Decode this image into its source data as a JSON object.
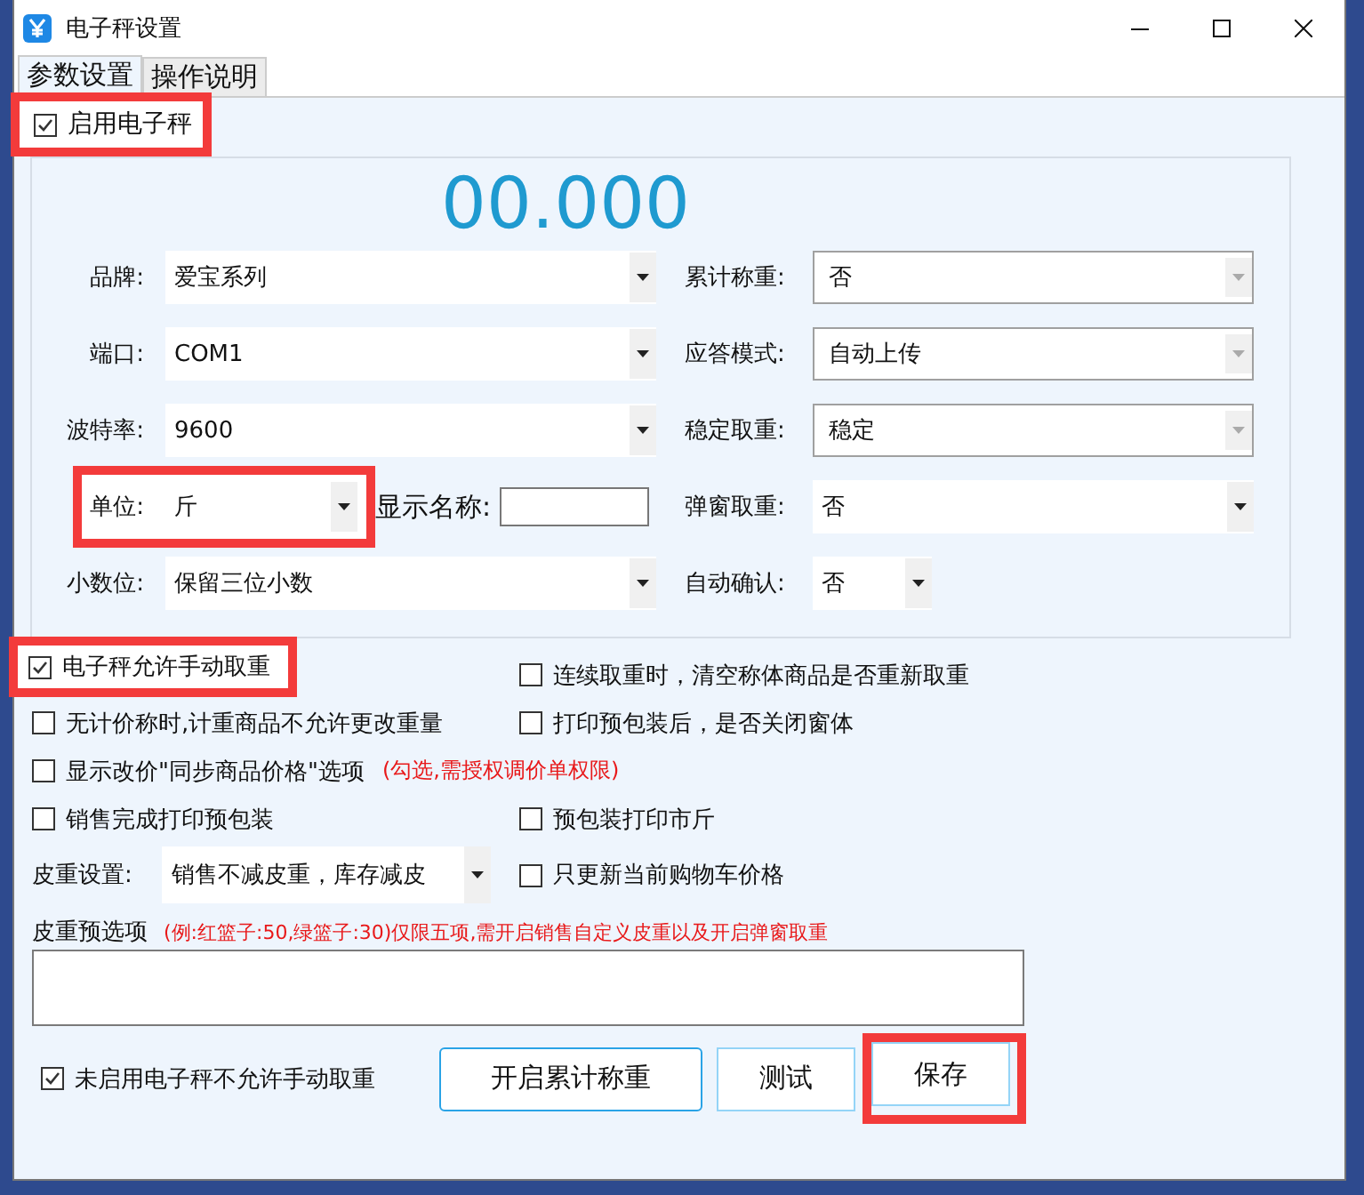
{
  "window": {
    "title": "电子秤设置"
  },
  "tabs": [
    {
      "label": "参数设置",
      "selected": true
    },
    {
      "label": "操作说明",
      "selected": false
    }
  ],
  "enable_scale": {
    "label": "启用电子秤",
    "checked": true,
    "highlighted": true
  },
  "weight_display": "00.000",
  "form_rows": [
    {
      "left": {
        "label": "品牌:",
        "value": "爱宝系列",
        "kind": "combo",
        "disabled": false
      },
      "right": {
        "label": "累计称重:",
        "value": "否",
        "kind": "combo",
        "disabled": true
      }
    },
    {
      "left": {
        "label": "端口:",
        "value": "COM1",
        "kind": "combo",
        "disabled": false
      },
      "right": {
        "label": "应答模式:",
        "value": "自动上传",
        "kind": "combo",
        "disabled": true
      }
    },
    {
      "left": {
        "label": "波特率:",
        "value": "9600",
        "kind": "combo",
        "disabled": false
      },
      "right": {
        "label": "稳定取重:",
        "value": "稳定",
        "kind": "combo",
        "disabled": true
      }
    },
    {
      "left": {
        "label": "单位:",
        "value": "斤",
        "kind": "unit",
        "disabled": false,
        "highlighted": true,
        "extra_label": "显示名称:"
      },
      "right": {
        "label": "弹窗取重:",
        "value": "否",
        "kind": "combo",
        "disabled": false
      }
    },
    {
      "left": {
        "label": "小数位:",
        "value": "保留三位小数",
        "kind": "combo",
        "disabled": false
      },
      "right": {
        "label": "自动确认:",
        "value": "否",
        "kind": "short",
        "disabled": false
      }
    }
  ],
  "option_rows": [
    {
      "left": {
        "kind": "checkbox",
        "label": "电子秤允许手动取重",
        "checked": true,
        "highlighted": true
      },
      "right": {
        "kind": "checkbox",
        "label": "连续取重时，清空称体商品是否重新取重",
        "checked": false
      }
    },
    {
      "left": {
        "kind": "checkbox",
        "label": "无计价称时,计重商品不允许更改重量",
        "checked": false
      },
      "right": {
        "kind": "checkbox",
        "label": "打印预包装后，是否关闭窗体",
        "checked": false
      }
    },
    {
      "left": {
        "kind": "checkbox",
        "label": "显示改价\"同步商品价格\"选项",
        "checked": false,
        "note": "(勾选,需授权调价单权限)"
      }
    },
    {
      "left": {
        "kind": "checkbox",
        "label": "销售完成打印预包装",
        "checked": false
      },
      "right": {
        "kind": "checkbox",
        "label": "预包装打印市斤",
        "checked": false
      }
    },
    {
      "left": {
        "kind": "combo",
        "label": "皮重设置:",
        "value": "销售不减皮重，库存减皮"
      },
      "right": {
        "kind": "checkbox",
        "label": "只更新当前购物车价格",
        "checked": false
      }
    }
  ],
  "tare_presets": {
    "label": "皮重预选项",
    "note": "(例:红篮子:50,绿篮子:30)仅限五项,需开启销售自定义皮重以及开启弹窗取重"
  },
  "bottom": {
    "checkbox": {
      "label": "未启用电子秤不允许手动取重",
      "checked": true
    },
    "buttons": [
      {
        "label": "开启累计称重",
        "highlighted": false,
        "kind": "primary"
      },
      {
        "label": "测试",
        "highlighted": false,
        "kind": "plain"
      },
      {
        "label": "保存",
        "highlighted": true,
        "kind": "plain"
      }
    ]
  }
}
